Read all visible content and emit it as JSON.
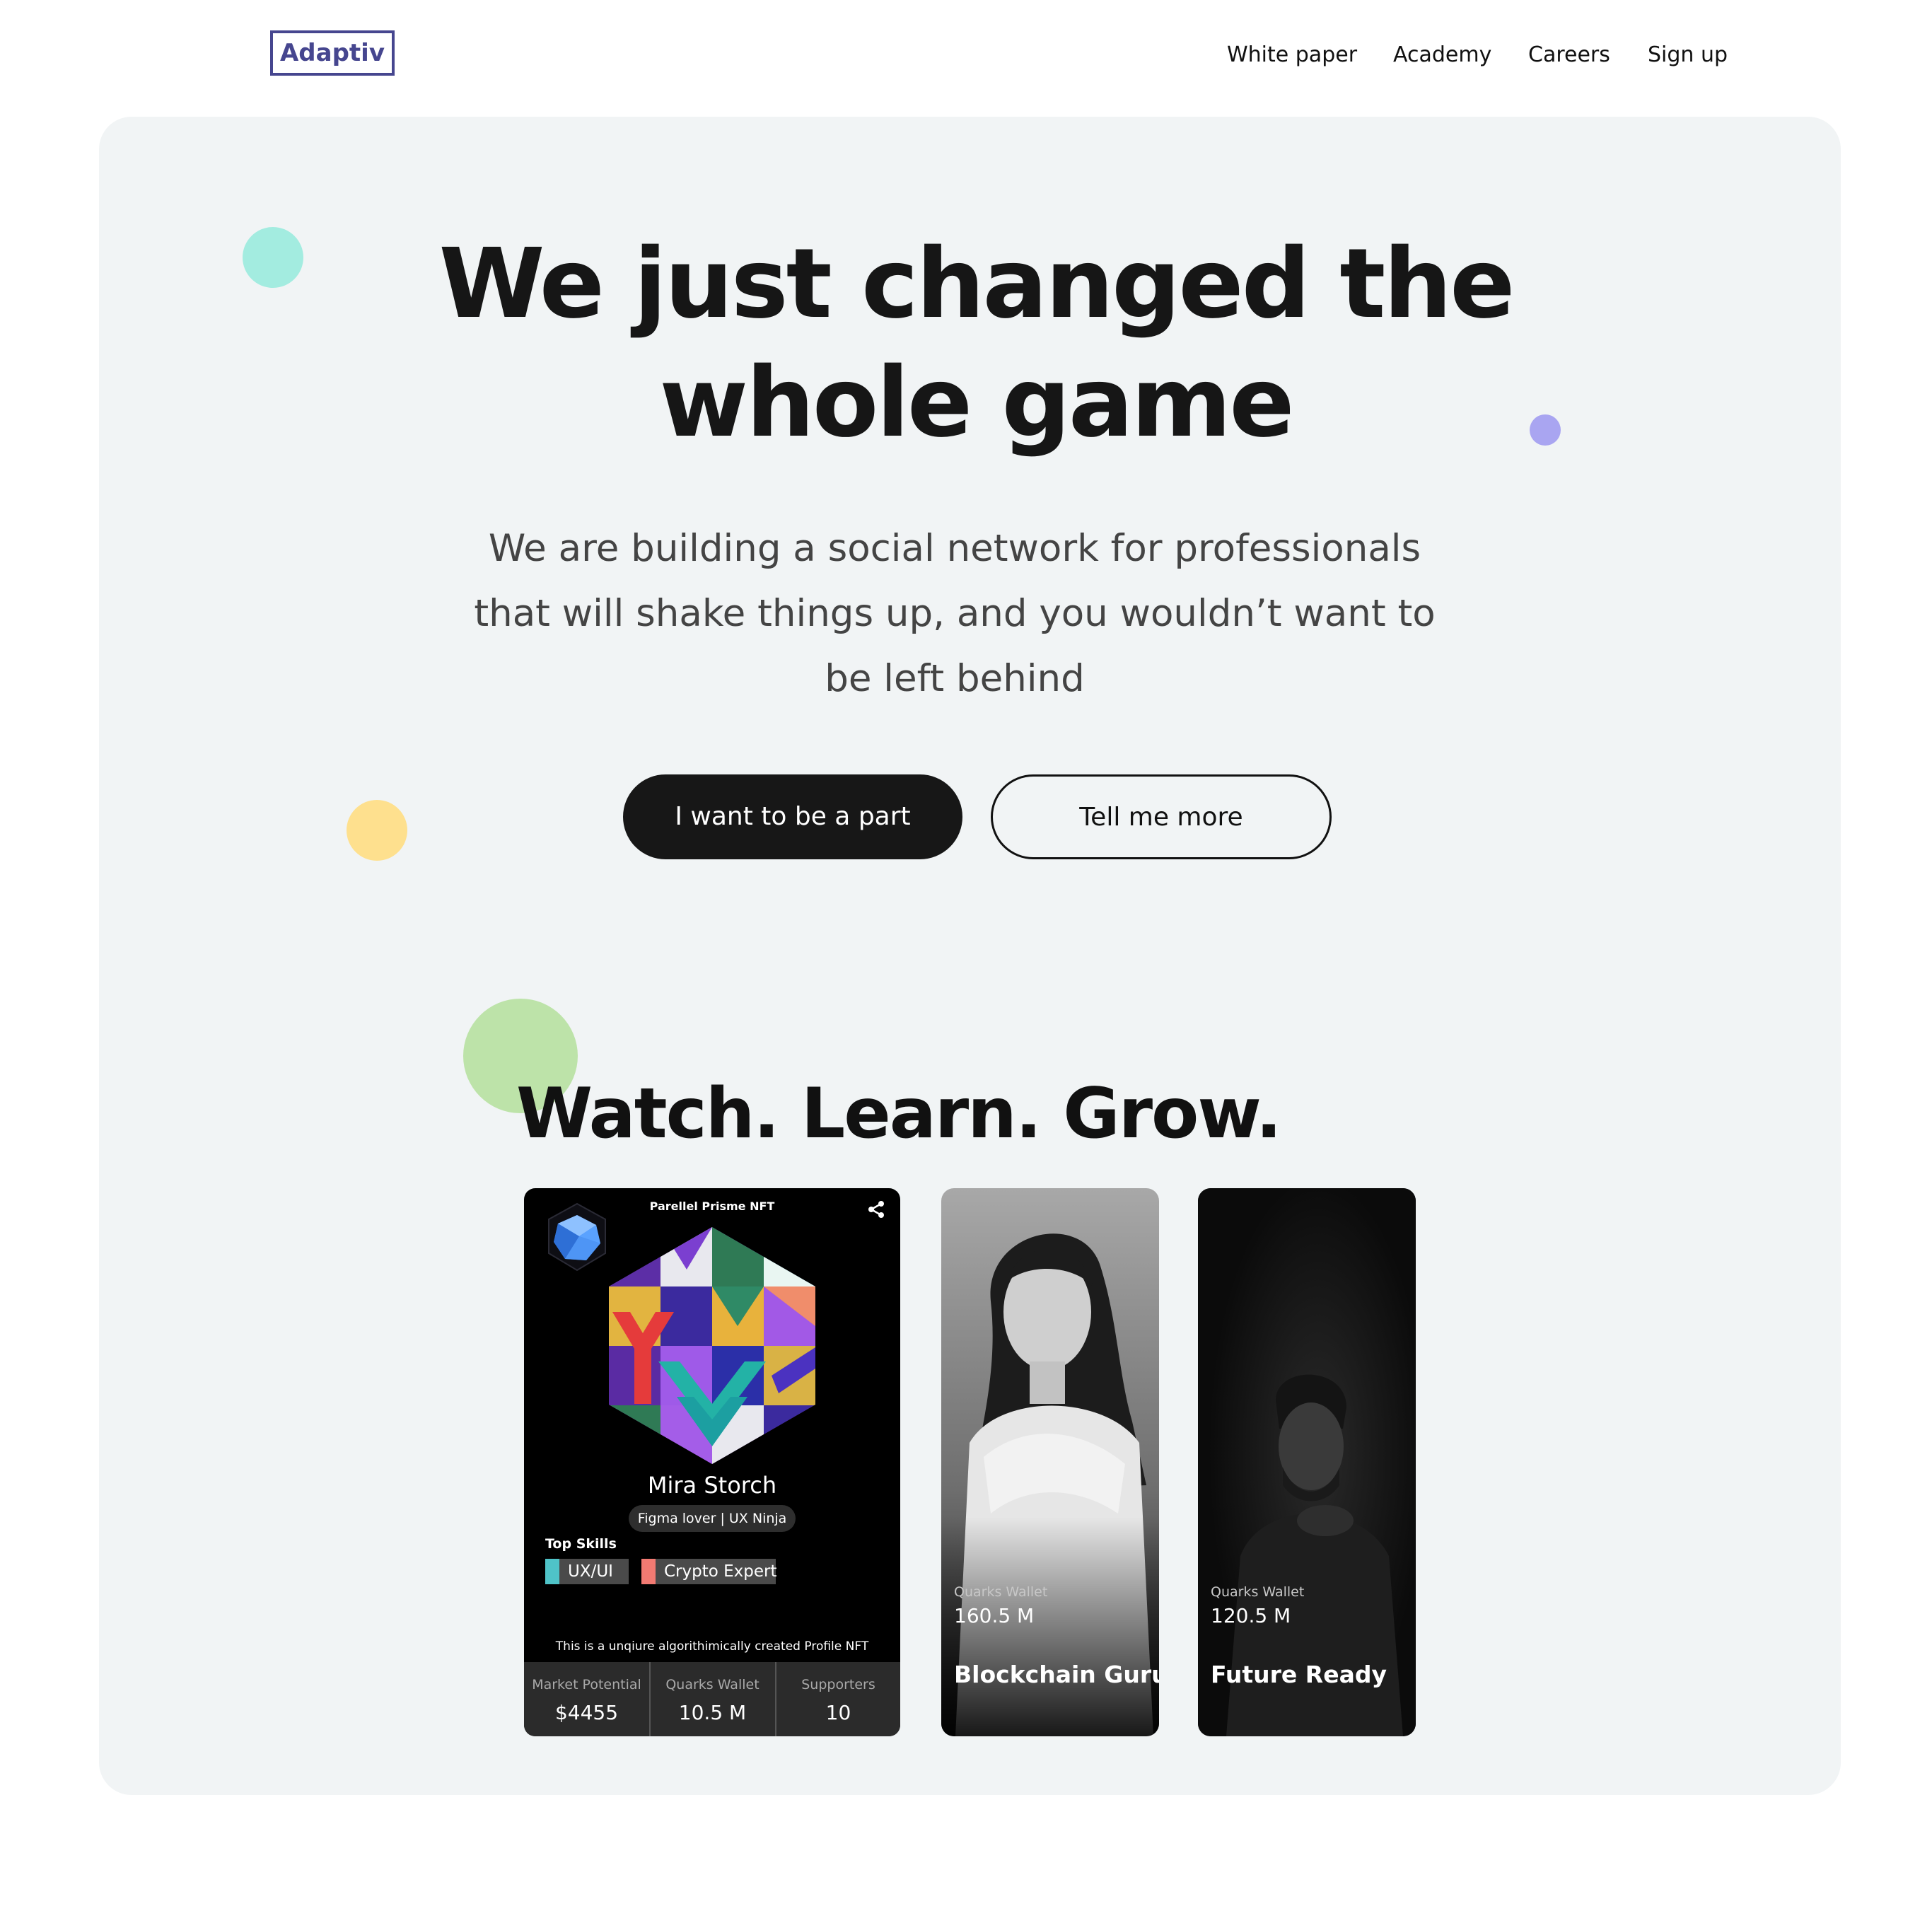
{
  "header": {
    "logo": "Adaptiv",
    "nav": [
      "White paper",
      "Academy",
      "Careers",
      "Sign up"
    ]
  },
  "hero": {
    "headline_line1": "We just changed the",
    "headline_line2": "whole game",
    "sub_line1": "We are building a social network for professionals",
    "sub_line2": "that will shake things up, and you wouldn’t want to",
    "sub_line3": "be left behind",
    "primary_cta": "I want to be a part",
    "secondary_cta": "Tell me more"
  },
  "section": {
    "title": "Watch. Learn. Grow."
  },
  "nft_card": {
    "title": "Parellel Prisme NFT",
    "name": "Mira Storch",
    "tagline": "Figma lover | UX Ninja",
    "skills_label": "Top Skills",
    "skills": [
      {
        "label": "UX/UI",
        "color": "#4fc3c8"
      },
      {
        "label": "Crypto Expert",
        "color": "#f27a72"
      }
    ],
    "description": "This is a unqiure algorithimically created Profile NFT",
    "stats": [
      {
        "label": "Market Potential",
        "value": "$4455"
      },
      {
        "label": "Quarks Wallet",
        "value": "10.5 M"
      },
      {
        "label": "Supporters",
        "value": "10"
      }
    ]
  },
  "profile_cards": [
    {
      "wallet_label": "Quarks Wallet",
      "wallet_value": "160.5 M",
      "role": "Blockchain Guru"
    },
    {
      "wallet_label": "Quarks Wallet",
      "wallet_value": "120.5 M",
      "role": "Future Ready"
    }
  ],
  "colors": {
    "brand": "#46468f",
    "panel": "#f1f4f5",
    "dot_teal": "#a3ece0",
    "dot_purple": "#a9a5f1",
    "dot_yellow": "#fee08e",
    "dot_green": "#bde3a9"
  }
}
